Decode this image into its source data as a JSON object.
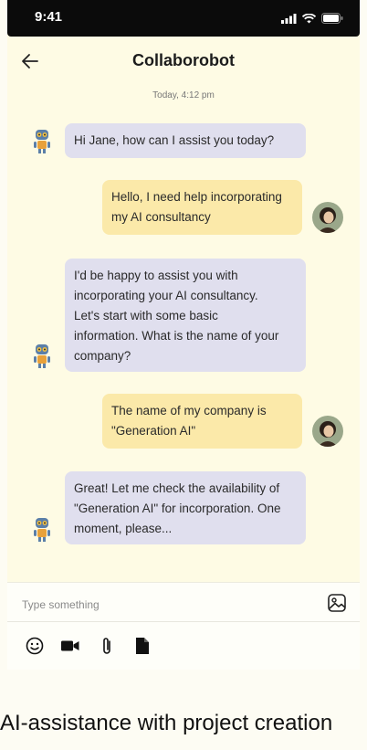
{
  "status_bar": {
    "time": "9:41"
  },
  "header": {
    "title": "Collaborobot"
  },
  "date_label": "Today, 4:12 pm",
  "messages": [
    {
      "sender": "bot",
      "text": "Hi Jane, how can I assist you today?"
    },
    {
      "sender": "user",
      "text": "Hello, I need help incorporating\nmy AI consultancy"
    },
    {
      "sender": "bot",
      "text": "I'd be happy to assist you with\nincorporating your AI consultancy.\nLet's start with some basic\ninformation. What is the name of your\ncompany?"
    },
    {
      "sender": "user",
      "text": "The name of my company is\n\"Generation AI\""
    },
    {
      "sender": "bot",
      "text": "Great! Let me check the availability of\n\"Generation AI\" for incorporation. One\nmoment, please..."
    }
  ],
  "composer": {
    "placeholder": "Type something"
  },
  "toolbar": {
    "icons": [
      "emoji-icon",
      "video-camera-icon",
      "paperclip-icon",
      "document-icon"
    ]
  },
  "caption": "AI-assistance with project creation"
}
